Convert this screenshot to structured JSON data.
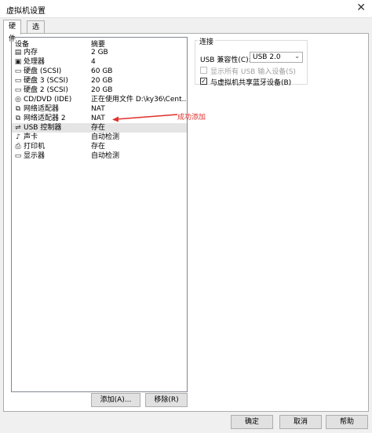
{
  "window": {
    "title": "虚拟机设置",
    "close_icon": "✕"
  },
  "tabs": [
    {
      "label": "硬件",
      "active": true
    },
    {
      "label": "选项",
      "active": false
    }
  ],
  "device_list": {
    "columns": [
      "设备",
      "摘要"
    ],
    "rows": [
      {
        "icon": "memory-icon",
        "glyph": "▤",
        "name": "内存",
        "summary": "2 GB"
      },
      {
        "icon": "cpu-icon",
        "glyph": "▣",
        "name": "处理器",
        "summary": "4"
      },
      {
        "icon": "disk-icon",
        "glyph": "▭",
        "name": "硬盘 (SCSI)",
        "summary": "60 GB"
      },
      {
        "icon": "disk-icon",
        "glyph": "▭",
        "name": "硬盘 3 (SCSI)",
        "summary": "20 GB"
      },
      {
        "icon": "disk-icon",
        "glyph": "▭",
        "name": "硬盘 2 (SCSI)",
        "summary": "20 GB"
      },
      {
        "icon": "cd-icon",
        "glyph": "◎",
        "name": "CD/DVD (IDE)",
        "summary": "正在使用文件 D:\\ky36\\Cent..."
      },
      {
        "icon": "network-icon",
        "glyph": "⧉",
        "name": "网络适配器",
        "summary": "NAT"
      },
      {
        "icon": "network-icon",
        "glyph": "⧉",
        "name": "网络适配器 2",
        "summary": "NAT"
      },
      {
        "icon": "usb-icon",
        "glyph": "⇌",
        "name": "USB 控制器",
        "summary": "存在",
        "selected": true
      },
      {
        "icon": "sound-icon",
        "glyph": "♪",
        "name": "声卡",
        "summary": "自动检测"
      },
      {
        "icon": "printer-icon",
        "glyph": "⎙",
        "name": "打印机",
        "summary": "存在"
      },
      {
        "icon": "display-icon",
        "glyph": "▭",
        "name": "显示器",
        "summary": "自动检测"
      }
    ]
  },
  "list_buttons": {
    "add": "添加(A)...",
    "remove": "移除(R)"
  },
  "connection": {
    "group_label": "连接",
    "compat_label": "USB 兼容性(C):",
    "compat_value": "USB 2.0",
    "show_all_label": "显示所有 USB 输入设备(S)",
    "show_all_checked": false,
    "share_bt_label": "与虚拟机共享蓝牙设备(B)",
    "share_bt_checked": true
  },
  "annotation": {
    "text": "成功添加",
    "color": "#e0302a"
  },
  "footer": {
    "ok": "确定",
    "cancel": "取消",
    "help": "帮助"
  }
}
